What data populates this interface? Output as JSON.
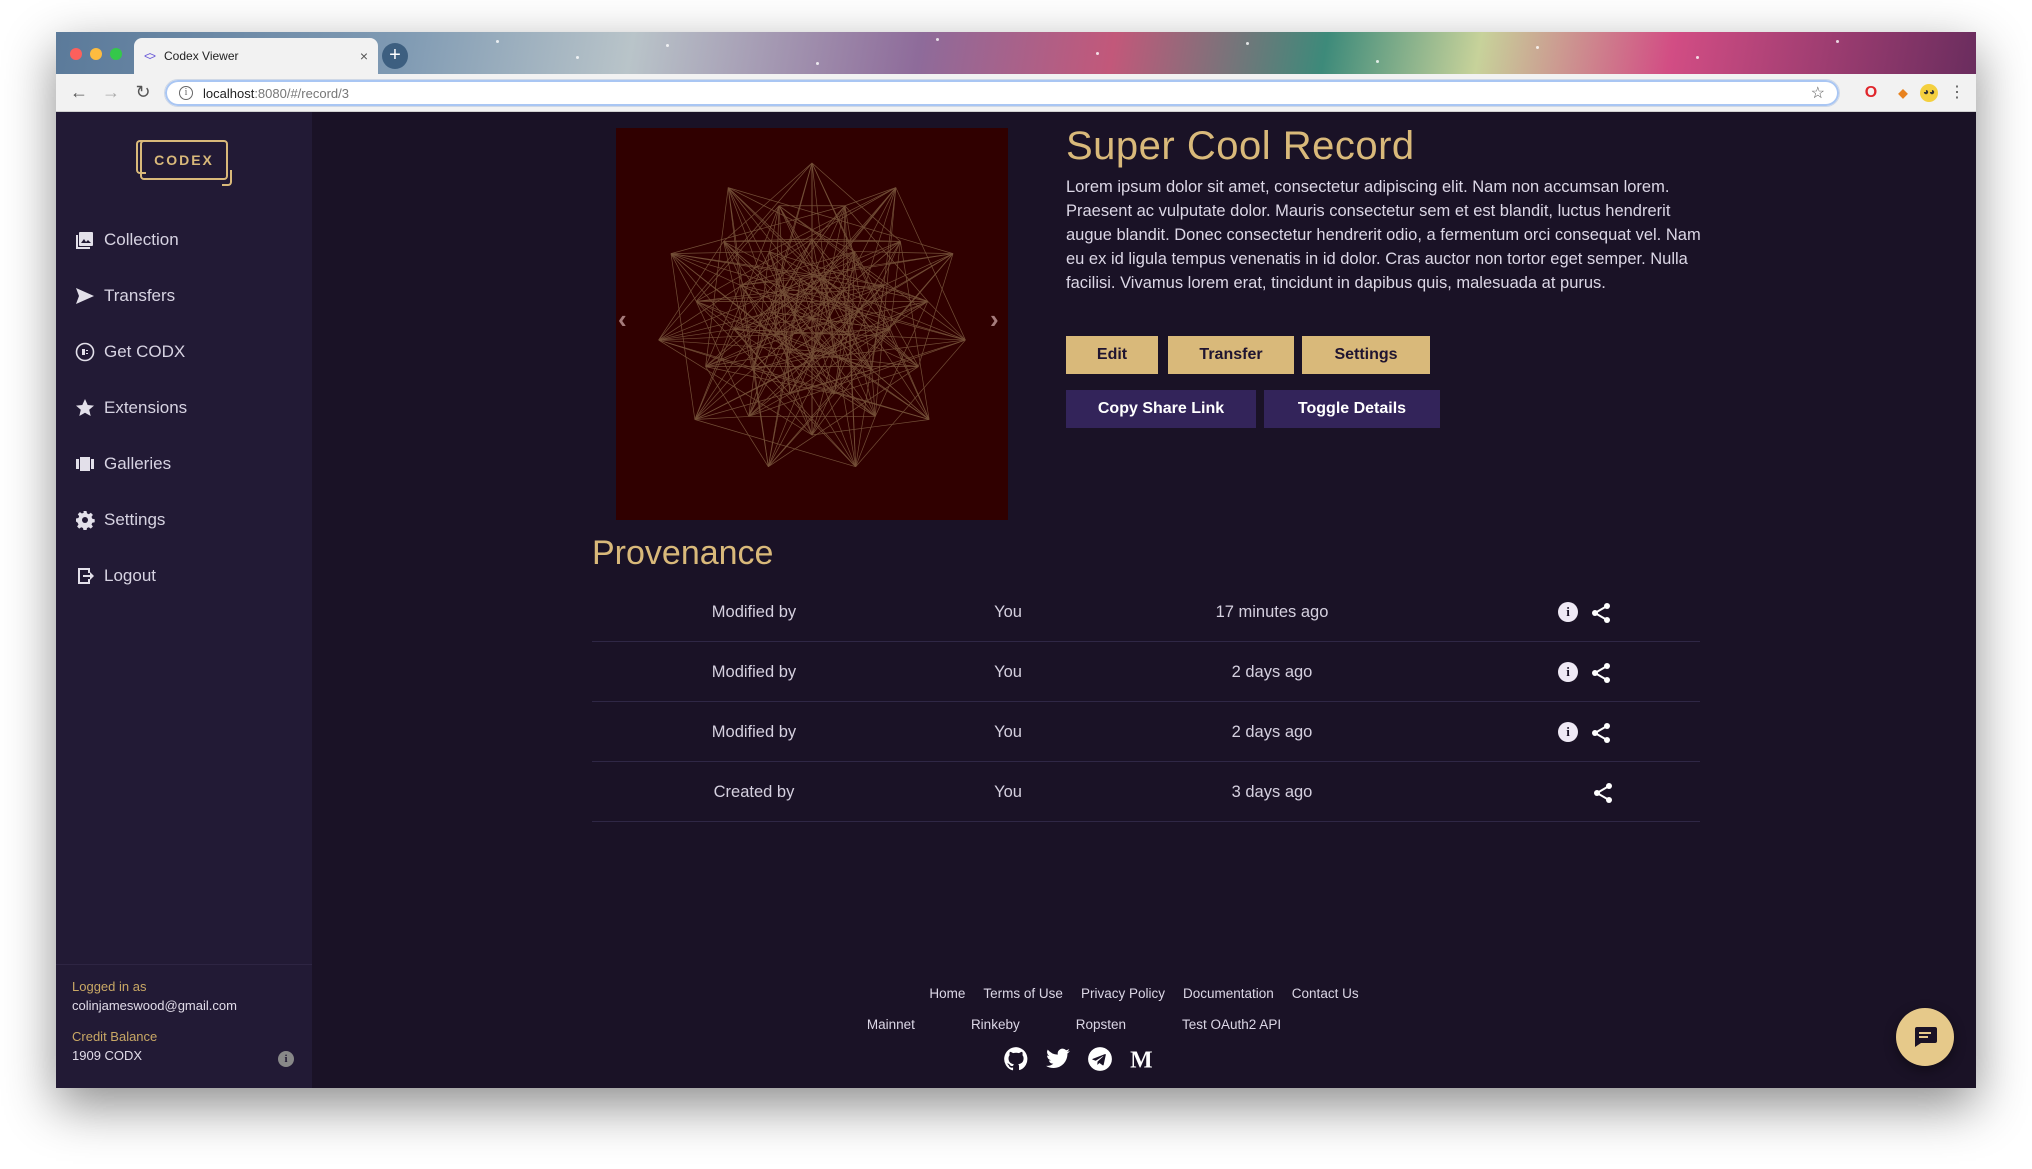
{
  "browser": {
    "tab_title": "Codex Viewer",
    "tab_close": "×",
    "new_tab": "+",
    "url_host": "localhost",
    "url_rest": ":8080/#/record/3"
  },
  "sidebar": {
    "logo": "CODEX",
    "items": [
      {
        "label": "Collection",
        "icon": "collection-icon"
      },
      {
        "label": "Transfers",
        "icon": "send-icon"
      },
      {
        "label": "Get CODX",
        "icon": "codx-coin-icon"
      },
      {
        "label": "Extensions",
        "icon": "star-icon"
      },
      {
        "label": "Galleries",
        "icon": "galleries-icon"
      },
      {
        "label": "Settings",
        "icon": "gear-icon"
      },
      {
        "label": "Logout",
        "icon": "logout-icon"
      }
    ],
    "logged_in_label": "Logged in as",
    "logged_in_email": "colinjameswood@gmail.com",
    "credit_label": "Credit Balance",
    "credit_value": "1909 CODX"
  },
  "record": {
    "title": "Super Cool Record",
    "description": "Lorem ipsum dolor sit amet, consectetur adipiscing elit. Nam non accumsan lorem. Praesent ac vulputate dolor. Mauris consectetur sem et est blandit, luctus hendrerit augue blandit. Donec consectetur hendrerit odio, a fermentum orci consequat vel. Nam eu ex id ligula tempus venenatis in id dolor. Cras auctor non tortor eget semper. Nulla facilisi. Vivamus lorem erat, tincidunt in dapibus quis, malesuada at purus.",
    "buttons": {
      "edit": "Edit",
      "transfer": "Transfer",
      "settings": "Settings",
      "copy_share": "Copy Share Link",
      "toggle_details": "Toggle Details"
    }
  },
  "provenance": {
    "title": "Provenance",
    "rows": [
      {
        "action": "Modified by",
        "who": "You",
        "when": "17 minutes ago",
        "has_info": true
      },
      {
        "action": "Modified by",
        "who": "You",
        "when": "2 days ago",
        "has_info": true
      },
      {
        "action": "Modified by",
        "who": "You",
        "when": "2 days ago",
        "has_info": true
      },
      {
        "action": "Created by",
        "who": "You",
        "when": "3 days ago",
        "has_info": false
      }
    ]
  },
  "footer": {
    "links": [
      "Home",
      "Terms of Use",
      "Privacy Policy",
      "Documentation",
      "Contact Us"
    ],
    "networks": [
      "Mainnet",
      "Rinkeby",
      "Ropsten",
      "Test OAuth2 API"
    ],
    "social": [
      "github-icon",
      "twitter-icon",
      "telegram-icon",
      "medium-icon"
    ]
  },
  "colors": {
    "accent_gold": "#d9b97a",
    "button_purple": "#33245a",
    "sidebar_bg": "#221a35",
    "main_bg": "#1a1226",
    "image_bg": "#300000"
  }
}
